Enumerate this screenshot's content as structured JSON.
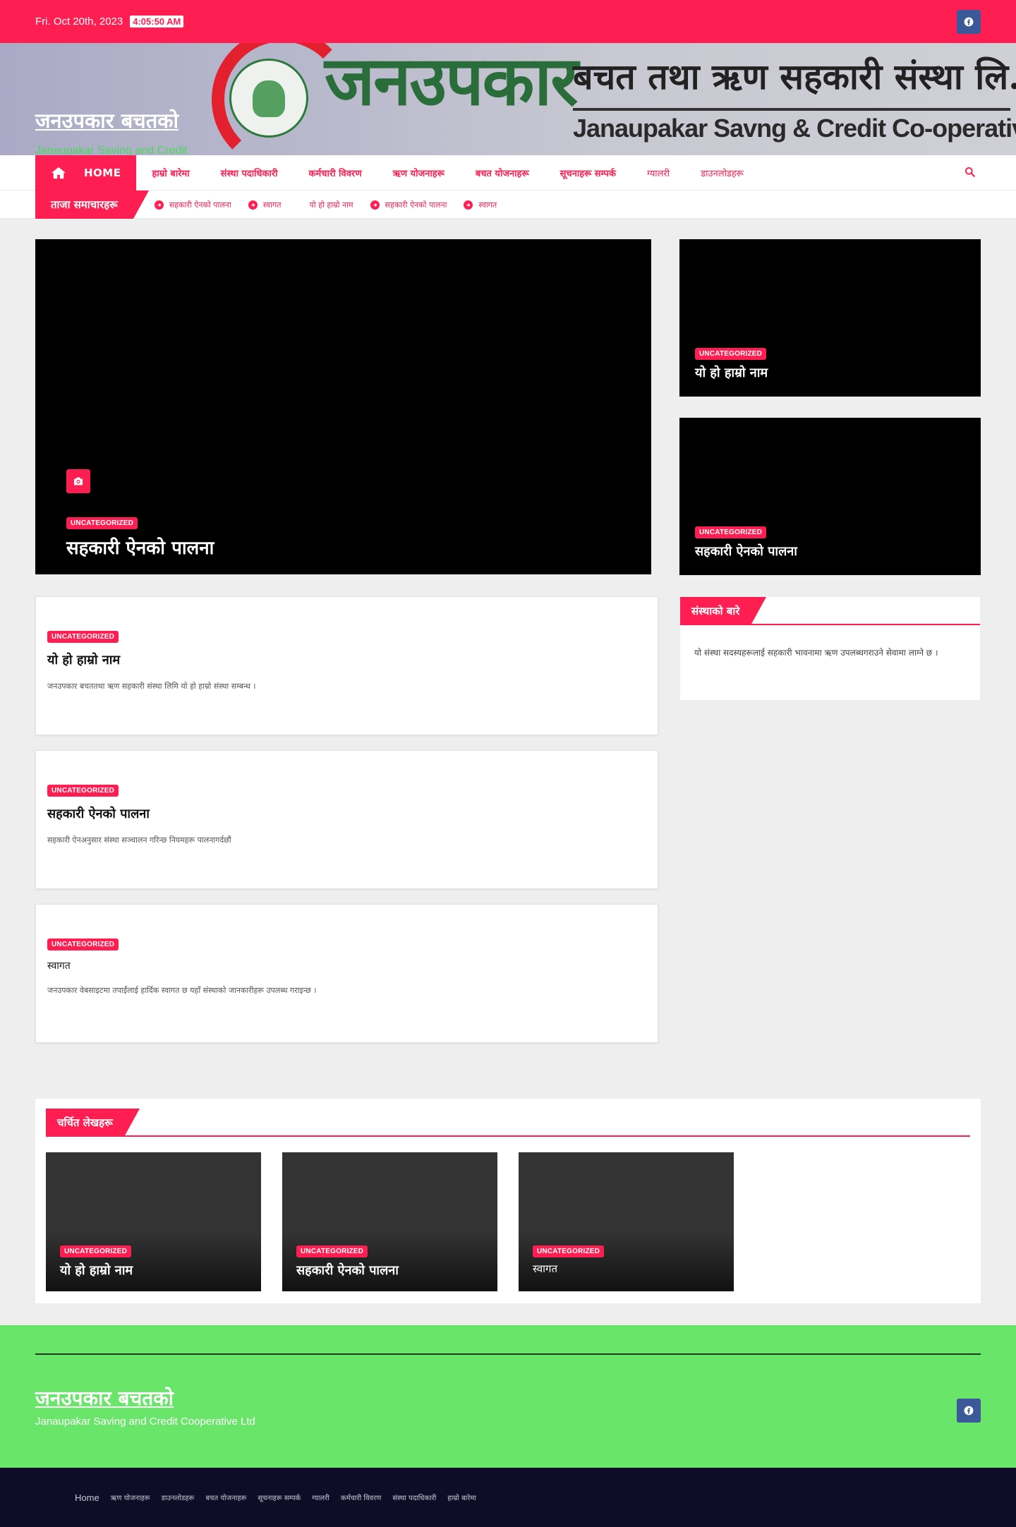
{
  "topbar": {
    "date": "Fri. Oct 20th, 2023",
    "time": "4:05:50 AM"
  },
  "header": {
    "site_title": "जनउपकार बचतको",
    "tagline": "Janaupakar Saving and Credit Cooperative Ltd",
    "banner_title": "जनउपकार",
    "banner_sub_np": "बचत तथा ऋण सहकारी संस्था लि.",
    "banner_sub_en": "Janaupakar Savng & Credit Co-operative Society Ltd."
  },
  "nav": {
    "home": "HOME",
    "items": [
      "हाम्रो बारेमा",
      "संस्था पदाधिकारी",
      "कर्मचारी विवरण",
      "ऋण योजनाहरू",
      "बचत योजनाहरू",
      "सूचनाहरू सम्पर्क",
      "ग्यालरी",
      "डाउनलोडहरू"
    ]
  },
  "ticker": {
    "label": "ताजा समाचारहरू",
    "items": [
      "सहकारी ऐनको पालना",
      "स्वागत",
      "यो हो हाम्रो नाम",
      "सहकारी ऐनको पालना",
      "स्वागत"
    ]
  },
  "featured": {
    "main": {
      "category": "UNCATEGORIZED",
      "title": "सहकारी ऐनको पालना"
    },
    "side": [
      {
        "category": "UNCATEGORIZED",
        "title": "यो हो हाम्रो नाम"
      },
      {
        "category": "UNCATEGORIZED",
        "title": "सहकारी ऐनको पालना"
      }
    ]
  },
  "posts": [
    {
      "category": "UNCATEGORIZED",
      "title": "यो हो हाम्रो नाम",
      "excerpt": "जनउपकार बचततथा ऋण सहकारी संस्था लिमि यो हो हाम्रो संस्था सम्बन्ध ।"
    },
    {
      "category": "UNCATEGORIZED",
      "title": "सहकारी ऐनको पालना",
      "excerpt": "सहकारी ऐनअनुसार संस्था सञ्चालन गरिन्छ नियमहरू पालनागर्दछौं"
    },
    {
      "category": "UNCATEGORIZED",
      "title": "स्वागत",
      "excerpt": "जनउपकार वेबसाइटमा तपाईंलाई हार्दिक स्वागत छ यहाँ संस्थाको जानकारीहरू उपलब्ध गराइन्छ ।"
    }
  ],
  "sidebar": {
    "heading": "संस्थाको बारे",
    "body": "यो संस्था सदस्यहरूलाई सहकारी भावनामा ऋण उपलब्धगराउने सेवामा लाग्ने छ ।"
  },
  "popular": {
    "heading": "चर्चित लेखहरू",
    "items": [
      {
        "category": "UNCATEGORIZED",
        "title": "यो हो हाम्रो नाम"
      },
      {
        "category": "UNCATEGORIZED",
        "title": "सहकारी ऐनको पालना"
      },
      {
        "category": "UNCATEGORIZED",
        "title": "स्वागत"
      }
    ]
  },
  "footer": {
    "site_title": "जनउपकार बचतको",
    "tagline": "Janaupakar Saving and Credit Cooperative Ltd",
    "links": [
      "Home",
      "ऋण योजनाहरू",
      "डाउनलोडहरू",
      "बचत योजनाहरू",
      "सूचनाहरू सम्पर्क",
      "ग्यालरी",
      "कर्मचारी विवरण",
      "संस्था पदाधिकारी",
      "हाम्रो बारेमा"
    ]
  },
  "colors": {
    "accent": "#ff1e51",
    "footer_bg": "#69e66a",
    "bottom_bg": "#0d0d28",
    "facebook": "#3b5998"
  },
  "icons": {
    "social": "facebook-icon",
    "home": "home-icon",
    "search": "search-icon",
    "camera": "camera-icon",
    "bullet": "arrow-circle-icon"
  }
}
